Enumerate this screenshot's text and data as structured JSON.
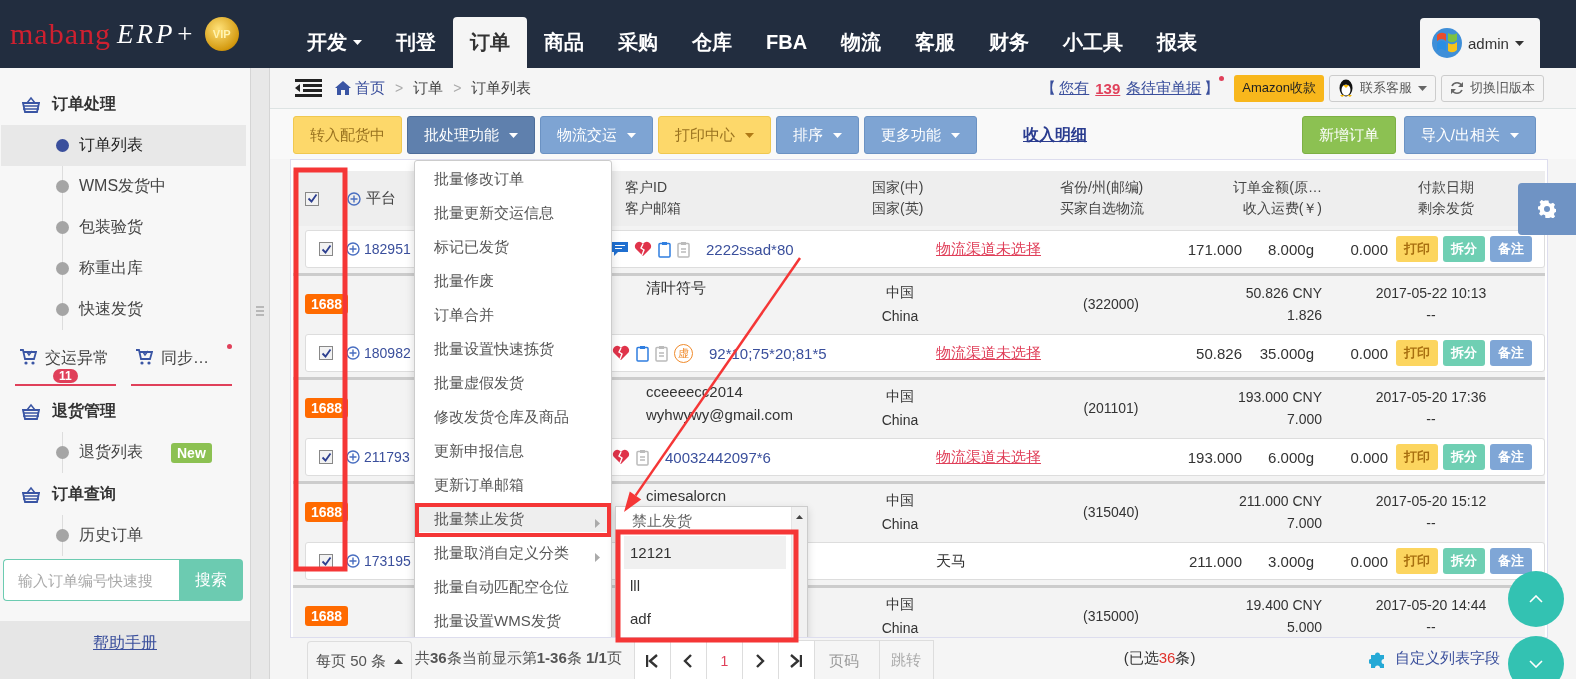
{
  "logo": {
    "brand": "mabang",
    "product": "ERP+",
    "badge": "VIP"
  },
  "nav": [
    {
      "label": "开发",
      "dropdown": true,
      "selected": false
    },
    {
      "label": "刊登",
      "dropdown": false,
      "selected": false
    },
    {
      "label": "订单",
      "dropdown": false,
      "selected": true
    },
    {
      "label": "商品",
      "dropdown": false,
      "selected": false
    },
    {
      "label": "采购",
      "dropdown": false,
      "selected": false
    },
    {
      "label": "仓库",
      "dropdown": false,
      "selected": false
    },
    {
      "label": "FBA",
      "dropdown": false,
      "selected": false
    },
    {
      "label": "物流",
      "dropdown": false,
      "selected": false
    },
    {
      "label": "客服",
      "dropdown": false,
      "selected": false
    },
    {
      "label": "财务",
      "dropdown": false,
      "selected": false
    },
    {
      "label": "小工具",
      "dropdown": false,
      "selected": false
    },
    {
      "label": "报表",
      "dropdown": false,
      "selected": false
    }
  ],
  "user": {
    "name": "admin"
  },
  "sidebar": {
    "sections": [
      {
        "kind": "heading",
        "label": "订单处理",
        "children": [
          {
            "label": "订单列表",
            "selected": true
          },
          {
            "label": "WMS发货中",
            "selected": false
          },
          {
            "label": "包装验货",
            "selected": false
          },
          {
            "label": "称重出库",
            "selected": false
          },
          {
            "label": "快速发货",
            "selected": false
          }
        ]
      },
      {
        "kind": "tabs",
        "items": [
          {
            "label": "交运异常",
            "badge": "11",
            "dot": false
          },
          {
            "label": "同步…",
            "dot": true
          }
        ]
      },
      {
        "kind": "heading",
        "label": "退货管理",
        "children": [
          {
            "label": "退货列表",
            "selected": false,
            "tag": "New"
          }
        ]
      },
      {
        "kind": "heading",
        "label": "订单查询",
        "children": [
          {
            "label": "历史订单",
            "selected": false
          }
        ]
      }
    ],
    "search": {
      "placeholder": "输入订单编号快速搜",
      "button": "搜索"
    },
    "help_link": "帮助手册"
  },
  "breadcrumb": {
    "home": "首页",
    "separator": ">",
    "path": [
      "订单",
      "订单列表"
    ]
  },
  "notice": {
    "open": "【",
    "before": "您有",
    "count": "139",
    "after": "条待审单据",
    "close": "】",
    "dot": true
  },
  "header_buttons": [
    {
      "label": "Amazon收款",
      "kind": "highlight",
      "dropdown": false
    },
    {
      "label": "联系客服",
      "kind": "contact",
      "dropdown": true
    },
    {
      "label": "切换旧版本",
      "kind": "refresh",
      "dropdown": false
    }
  ],
  "toolbar": [
    {
      "label": "转入配货中",
      "kind": "warning",
      "dropdown": false
    },
    {
      "label": "批处理功能",
      "kind": "active",
      "dropdown": true
    },
    {
      "label": "物流交运",
      "kind": "primary",
      "dropdown": true
    },
    {
      "label": "打印中心",
      "kind": "warning",
      "dropdown": true
    },
    {
      "label": "排序",
      "kind": "primary",
      "dropdown": true
    },
    {
      "label": "更多功能",
      "kind": "primary",
      "dropdown": true
    },
    {
      "label": "收入明细",
      "kind": "link",
      "dropdown": false
    },
    {
      "label": "新增订单",
      "kind": "success",
      "dropdown": false
    },
    {
      "label": "导入/出相关",
      "kind": "primary",
      "dropdown": true
    }
  ],
  "table": {
    "header": {
      "checked": true,
      "platform": "平台",
      "columns": [
        [
          "客户ID",
          "客户邮箱"
        ],
        [
          "国家(中)",
          "国家(英)"
        ],
        [
          "省份/州(邮编)",
          "买家自选物流"
        ],
        [
          "订单金额(原…",
          "收入运费(￥)"
        ],
        [
          "付款日期",
          "剩余发货"
        ]
      ]
    },
    "orders": [
      {
        "detail": {
          "checked": true,
          "order_id": "182951",
          "icons": [
            {
              "kind": "message"
            },
            {
              "kind": "heart"
            },
            {
              "kind": "clipboard"
            },
            {
              "kind": "pending"
            }
          ],
          "sku": "2222ssad*80",
          "logistics": {
            "text": "物流渠道未选择",
            "unset": true
          },
          "total": "171.000",
          "weight": "8.000g",
          "fee": "0.000",
          "actions": [
            {
              "label": "打印",
              "kind": "print"
            },
            {
              "label": "拆分",
              "kind": "split"
            },
            {
              "label": "备注",
              "kind": "note"
            }
          ]
        }
      },
      {
        "summary": {
          "platform": "1688",
          "customer": [
            "清叶符号"
          ],
          "country": [
            "中国",
            "China"
          ],
          "postcode": "(322000)",
          "amount": [
            "50.826 CNY",
            "1.826"
          ],
          "date": [
            "2017-05-22 10:13",
            "--"
          ]
        },
        "detail": {
          "checked": true,
          "order_id": "180982",
          "icons": [
            {
              "kind": "heart"
            },
            {
              "kind": "clipboard"
            },
            {
              "kind": "pending"
            },
            {
              "kind": "stamp",
              "label": "虚"
            }
          ],
          "sku": "92*10;75*20;81*5",
          "logistics": {
            "text": "物流渠道未选择",
            "unset": true
          },
          "total": "50.826",
          "weight": "35.000g",
          "fee": "0.000",
          "actions": [
            {
              "label": "打印",
              "kind": "print"
            },
            {
              "label": "拆分",
              "kind": "split"
            },
            {
              "label": "备注",
              "kind": "note"
            }
          ]
        }
      },
      {
        "summary": {
          "platform": "1688",
          "customer": [
            "cceeeecc2014",
            "wyhwywy@gmail.com"
          ],
          "country": [
            "中国",
            "China"
          ],
          "postcode": "(201101)",
          "amount": [
            "193.000 CNY",
            "7.000"
          ],
          "date": [
            "2017-05-20 17:36",
            "--"
          ]
        },
        "detail": {
          "checked": true,
          "order_id": "211793",
          "icons": [
            {
              "kind": "heart"
            },
            {
              "kind": "pending"
            }
          ],
          "sku": "40032442097*6",
          "logistics": {
            "text": "物流渠道未选择",
            "unset": true
          },
          "total": "193.000",
          "weight": "6.000g",
          "fee": "0.000",
          "actions": [
            {
              "label": "打印",
              "kind": "print"
            },
            {
              "label": "拆分",
              "kind": "split"
            },
            {
              "label": "备注",
              "kind": "note"
            }
          ]
        }
      },
      {
        "summary": {
          "platform": "1688",
          "customer": [
            "cimesalorcn"
          ],
          "country": [
            "中国",
            "China"
          ],
          "postcode": "(315040)",
          "amount": [
            "211.000 CNY",
            "7.000"
          ],
          "date": [
            "2017-05-20 15:12",
            "--"
          ]
        },
        "detail": {
          "checked": true,
          "order_id": "173195",
          "logistics": {
            "text": "天马",
            "unset": false
          },
          "total": "211.000",
          "weight": "3.000g",
          "fee": "0.000",
          "actions": [
            {
              "label": "打印",
              "kind": "print"
            },
            {
              "label": "拆分",
              "kind": "split"
            },
            {
              "label": "备注",
              "kind": "note"
            }
          ]
        }
      },
      {
        "summary": {
          "platform": "1688",
          "country": [
            "中国",
            "China"
          ],
          "postcode": "(315000)",
          "amount": [
            "19.400 CNY",
            "5.000"
          ],
          "date": [
            "2017-05-20 14:44",
            "--"
          ]
        }
      }
    ]
  },
  "batch_menu": {
    "items": [
      {
        "label": "批量修改订单",
        "submenu": false,
        "selected": false
      },
      {
        "label": "批量更新交运信息",
        "submenu": false,
        "selected": false
      },
      {
        "label": "标记已发货",
        "submenu": false,
        "selected": false
      },
      {
        "label": "批量作废",
        "submenu": false,
        "selected": false
      },
      {
        "label": "订单合并",
        "submenu": false,
        "selected": false
      },
      {
        "label": "批量设置快速拣货",
        "submenu": false,
        "selected": false
      },
      {
        "label": "批量虚假发货",
        "submenu": false,
        "selected": false
      },
      {
        "label": "修改发货仓库及商品",
        "submenu": false,
        "selected": false
      },
      {
        "label": "更新申报信息",
        "submenu": false,
        "selected": false
      },
      {
        "label": "更新订单邮箱",
        "submenu": false,
        "selected": false
      },
      {
        "label": "批量禁止发货",
        "submenu": true,
        "selected": true
      },
      {
        "label": "批量取消自定义分类",
        "submenu": true,
        "selected": false
      },
      {
        "label": "批量自动匹配空仓位",
        "submenu": false,
        "selected": false
      },
      {
        "label": "批量设置WMS发货",
        "submenu": false,
        "selected": false
      }
    ]
  },
  "submenu": {
    "header": "禁止发货",
    "items": [
      {
        "label": "12121",
        "selected": true
      },
      {
        "label": "lll",
        "selected": false
      },
      {
        "label": "adf",
        "selected": false
      }
    ]
  },
  "footer": {
    "page_size": "每页 50 条",
    "summary": "共**36**条当前显示第**1-36**条 **1/1**页",
    "pages": [
      {
        "label": "1",
        "selected": true
      }
    ],
    "page_placeholder": "页码",
    "go": "跳转",
    "selected_before": "(已选",
    "selected_count": "36",
    "selected_after": "条)",
    "custom_fields": "自定义列表字段"
  }
}
